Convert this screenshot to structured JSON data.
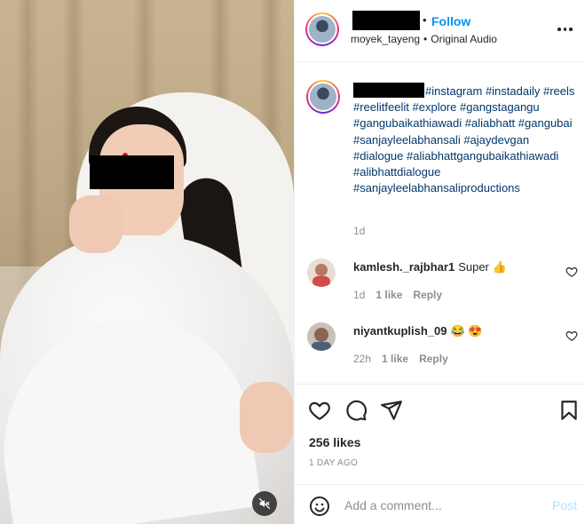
{
  "post": {
    "username_redacted": true,
    "follow_label": "Follow",
    "follow_separator": "•",
    "audio_user": "moyek_tayeng",
    "audio_separator": "•",
    "audio_label": "Original Audio"
  },
  "caption": {
    "hashtags": [
      "#instagram",
      "#instadaily",
      "#reels",
      "#reelitfeelit",
      "#explore",
      "#gangstagangu",
      "#gangubaikathiawadi",
      "#aliabhatt",
      "#gangubai",
      "#sanjayleelabhansali",
      "#ajaydevgan",
      "#dialogue",
      "#aliabhattgangubaikathiawadi",
      "#alibhattdialogue",
      "#sanjayleelabhansaliproductions"
    ],
    "time": "1d"
  },
  "comments": [
    {
      "username": "kamlesh._rajbhar1",
      "text": "Super 👍",
      "time": "1d",
      "likes": "1 like",
      "reply": "Reply",
      "avatar_color": "#d44a4a"
    },
    {
      "username": "niyantkuplish_09",
      "text": "😂 😍",
      "time": "22h",
      "likes": "1 like",
      "reply": "Reply",
      "avatar_color": "#7a5a48"
    }
  ],
  "actions": {
    "icons": [
      "heart-icon",
      "comment-icon",
      "share-icon",
      "bookmark-icon"
    ],
    "likes_label": "256 likes",
    "date_label": "1 DAY AGO"
  },
  "add_comment": {
    "placeholder": "Add a comment...",
    "post_label": "Post"
  },
  "colors": {
    "link_blue": "#0095f6",
    "hashtag": "#00376b",
    "muted": "#8e8e8e",
    "post_disabled": "#b2dffc"
  }
}
